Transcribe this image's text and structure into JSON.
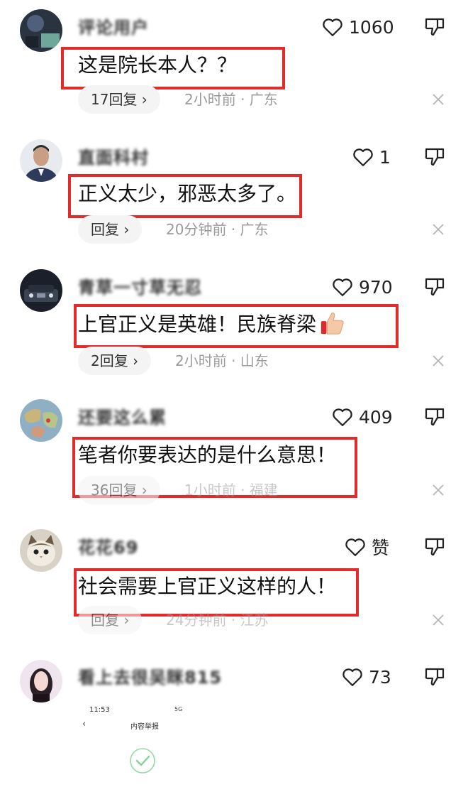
{
  "comments": [
    {
      "username": "评论用户",
      "likes": "1060",
      "text": "这是院长本人？？",
      "reply_label": "17回复 ›",
      "meta": "2小时前 · 广东"
    },
    {
      "username": "直面科村",
      "likes": "1",
      "text": "正义太少，邪恶太多了。",
      "reply_label": "回复 ›",
      "meta": "20分钟前 · 广东"
    },
    {
      "username": "青草一寸草无忍",
      "likes": "970",
      "text": "上官正义是英雄！民族脊梁",
      "reply_label": "2回复 ›",
      "meta": "2小时前 · 山东"
    },
    {
      "username": "还要这么累",
      "likes": "409",
      "text": "笔者你要表达的是什么意思！",
      "reply_label": "36回复 ›",
      "meta": "1小时前 · 福建"
    },
    {
      "username": "花花69",
      "likes": "赞",
      "text": "社会需要上官正义这样的人！",
      "reply_label": "回复 ›",
      "meta": "24分钟前 · 江苏"
    },
    {
      "username": "看上去很吴眯815",
      "likes": "73"
    }
  ],
  "nested_screenshot": {
    "time": "11:53",
    "status": "5G",
    "back": "‹",
    "title": "内容举报"
  },
  "icons": {
    "like": "heart-outline-icon",
    "dislike": "thumbs-down-outline-icon",
    "close": "close-x-icon",
    "check": "check-circle-icon",
    "emoji": "thumbs-up-emoji"
  },
  "colors": {
    "highlight_box": "#e22b2b",
    "meta_text": "#9a9a9a",
    "pill_bg": "#f4f4f4",
    "check_green": "#4cbf6a"
  }
}
